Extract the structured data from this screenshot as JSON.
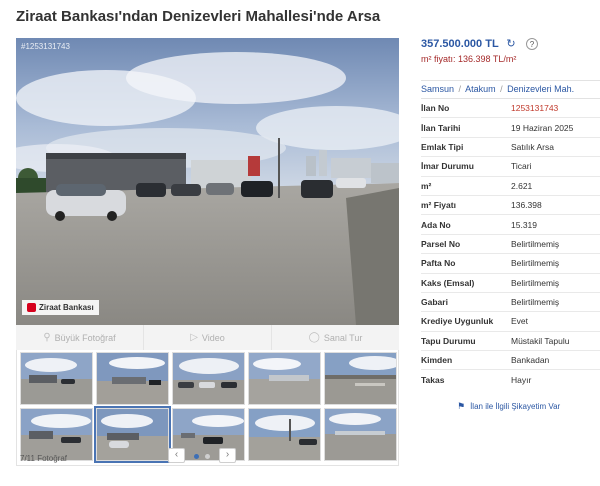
{
  "listing": {
    "title": "Ziraat Bankası'ndan Denizevleri Mahallesi'nde Arsa",
    "photo_id": "#1253131743",
    "bank_logo_text": "Ziraat Bankası"
  },
  "media_bar": {
    "big_photo": "Büyük Fotoğraf",
    "video": "Video",
    "virtual_tour": "Sanal Tur"
  },
  "gallery": {
    "count_label": "7/11 Fotoğraf",
    "prev": "‹",
    "next": "›"
  },
  "price": {
    "amount": "357.500.000 TL",
    "unit_price": "m² fiyatı: 136.398 TL/m²"
  },
  "breadcrumb": [
    "Samsun",
    "Atakum",
    "Denizevleri Mah."
  ],
  "details": [
    {
      "label": "İlan No",
      "value": "1253131743",
      "highlight": true
    },
    {
      "label": "İlan Tarihi",
      "value": "19 Haziran 2025"
    },
    {
      "label": "Emlak Tipi",
      "value": "Satılık Arsa"
    },
    {
      "label": "İmar Durumu",
      "value": "Ticari"
    },
    {
      "label": "m²",
      "value": "2.621"
    },
    {
      "label": "m² Fiyatı",
      "value": "136.398"
    },
    {
      "label": "Ada No",
      "value": "15.319"
    },
    {
      "label": "Parsel No",
      "value": "Belirtilmemiş"
    },
    {
      "label": "Pafta No",
      "value": "Belirtilmemiş"
    },
    {
      "label": "Kaks (Emsal)",
      "value": "Belirtilmemiş"
    },
    {
      "label": "Gabari",
      "value": "Belirtilmemiş"
    },
    {
      "label": "Krediye Uygunluk",
      "value": "Evet"
    },
    {
      "label": "Tapu Durumu",
      "value": "Müstakil Tapulu"
    },
    {
      "label": "Kimden",
      "value": "Bankadan"
    },
    {
      "label": "Takas",
      "value": "Hayır"
    }
  ],
  "complaint_link": "İlan ile İlgili Şikayetim Var",
  "colors": {
    "link_blue": "#2b57a3",
    "price_red": "#a52a2a",
    "listing_no_red": "#c0392b"
  }
}
